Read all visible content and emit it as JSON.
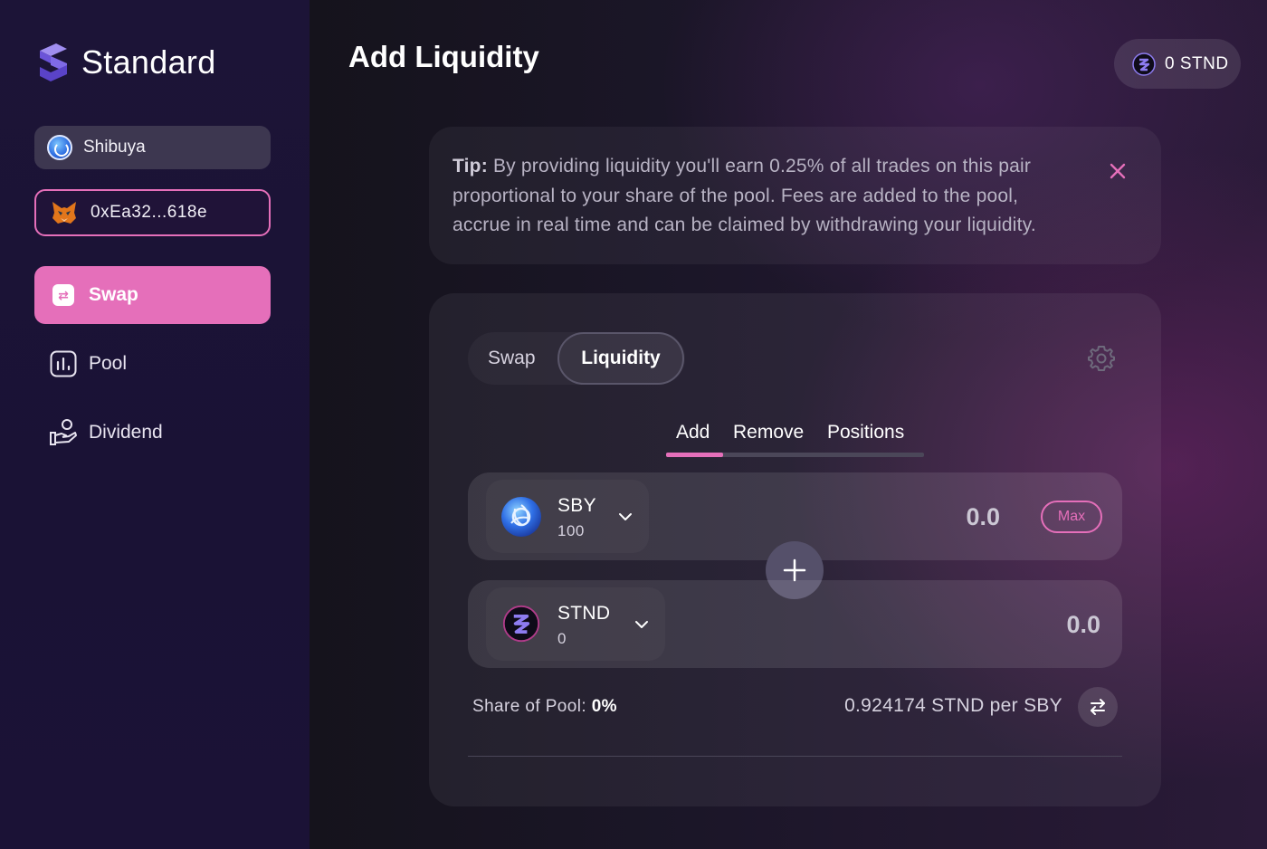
{
  "brand": {
    "name": "Standard"
  },
  "sidebar": {
    "network": "Shibuya",
    "wallet": "0xEa32...618e",
    "nav": [
      {
        "label": "Swap",
        "active": true
      },
      {
        "label": "Pool",
        "active": false
      },
      {
        "label": "Dividend",
        "active": false
      }
    ]
  },
  "header": {
    "title": "Add Liquidity",
    "balance": "0 STND"
  },
  "tip": {
    "label": "Tip:",
    "text": "By providing liquidity you'll earn 0.25% of all trades on this pair proportional to your share of the pool. Fees are added to the pool, accrue in real time and can be claimed by withdrawing your liquidity."
  },
  "mode_toggle": {
    "options": [
      "Swap",
      "Liquidity"
    ],
    "selected": "Liquidity"
  },
  "subtabs": {
    "items": [
      "Add",
      "Remove",
      "Positions"
    ],
    "selected": "Add"
  },
  "token_a": {
    "symbol": "SBY",
    "balance": "100",
    "amount": "0.0",
    "max_label": "Max"
  },
  "token_b": {
    "symbol": "STND",
    "balance": "0",
    "amount": "0.0"
  },
  "pool_info": {
    "share_label": "Share of Pool:",
    "share_value": "0%",
    "rate": "0.924174 STND per SBY"
  },
  "colors": {
    "accent": "#e56fba",
    "sidebar_bg": "#1c1437",
    "card_bg": "#2a2535"
  }
}
